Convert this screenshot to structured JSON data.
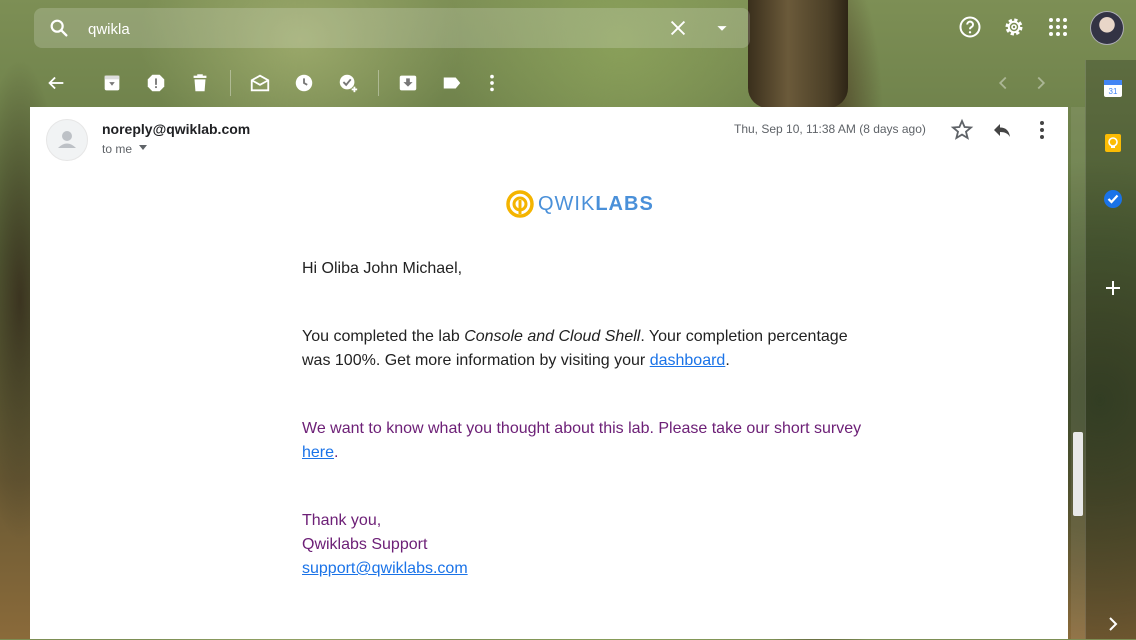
{
  "search": {
    "value": "qwikla"
  },
  "email": {
    "sender": "noreply@qwiklab.com",
    "recipient_label": "to me",
    "date": "Thu, Sep 10, 11:38 AM (8 days ago)"
  },
  "logo": {
    "part1": "QWIK",
    "part2": "LABS"
  },
  "body": {
    "greeting": "Hi Oliba John Michael,",
    "para1_prefix": "You completed the lab ",
    "lab_name": "Console and Cloud Shell",
    "para1_mid": ". Your completion percentage was 100%. Get more information by visiting your ",
    "dashboard_link": "dashboard",
    "para1_end": ".",
    "para2_prefix": "We want to know what you thought about this lab. Please take our short survey ",
    "survey_link": "here",
    "para2_end": ".",
    "signoff": "Thank you,",
    "signature": "Qwiklabs Support",
    "support_email": "support@qwiklabs.com"
  },
  "side_panel": {
    "calendar_date": "31"
  },
  "colors": {
    "link": "#1a73e8",
    "purple_text": "#6d2077",
    "logo_blue": "#4a90d9",
    "logo_yellow": "#f4b400"
  }
}
